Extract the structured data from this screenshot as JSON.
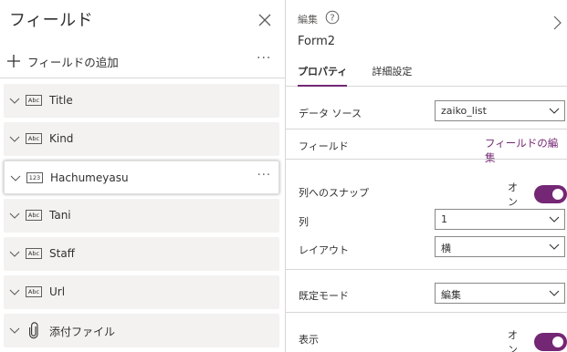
{
  "left": {
    "title": "フィールド",
    "add_label": "フィールドの追加",
    "more": "···",
    "fields": [
      {
        "type": "Abc",
        "name": "Title",
        "icon": "text-field-icon"
      },
      {
        "type": "Abc",
        "name": "Kind",
        "icon": "text-field-icon"
      },
      {
        "type": "123",
        "name": "Hachumeyasu",
        "icon": "number-field-icon",
        "selected": true
      },
      {
        "type": "Abc",
        "name": "Tani",
        "icon": "text-field-icon"
      },
      {
        "type": "Abc",
        "name": "Staff",
        "icon": "text-field-icon"
      },
      {
        "type": "Abc",
        "name": "Url",
        "icon": "text-field-icon"
      },
      {
        "type": "",
        "name": "添付ファイル",
        "icon": "paperclip-icon"
      }
    ]
  },
  "right": {
    "edit_label": "編集",
    "form_name": "Form2",
    "tabs": [
      {
        "label": "プロパティ",
        "active": true
      },
      {
        "label": "詳細設定",
        "active": false
      }
    ],
    "datasource": {
      "label": "データ ソース",
      "value": "zaiko_list"
    },
    "fields_row": {
      "label": "フィールド",
      "link": "フィールドの編集"
    },
    "snap": {
      "label": "列へのスナップ",
      "state": "オン"
    },
    "columns": {
      "label": "列",
      "value": "1"
    },
    "layout": {
      "label": "レイアウト",
      "value": "横"
    },
    "default_mode": {
      "label": "既定モード",
      "value": "編集"
    },
    "visible": {
      "label": "表示",
      "state": "オン"
    }
  },
  "colors": {
    "accent": "#742774",
    "field_bg": "#f3f2f1",
    "border": "#d6d6d6"
  }
}
